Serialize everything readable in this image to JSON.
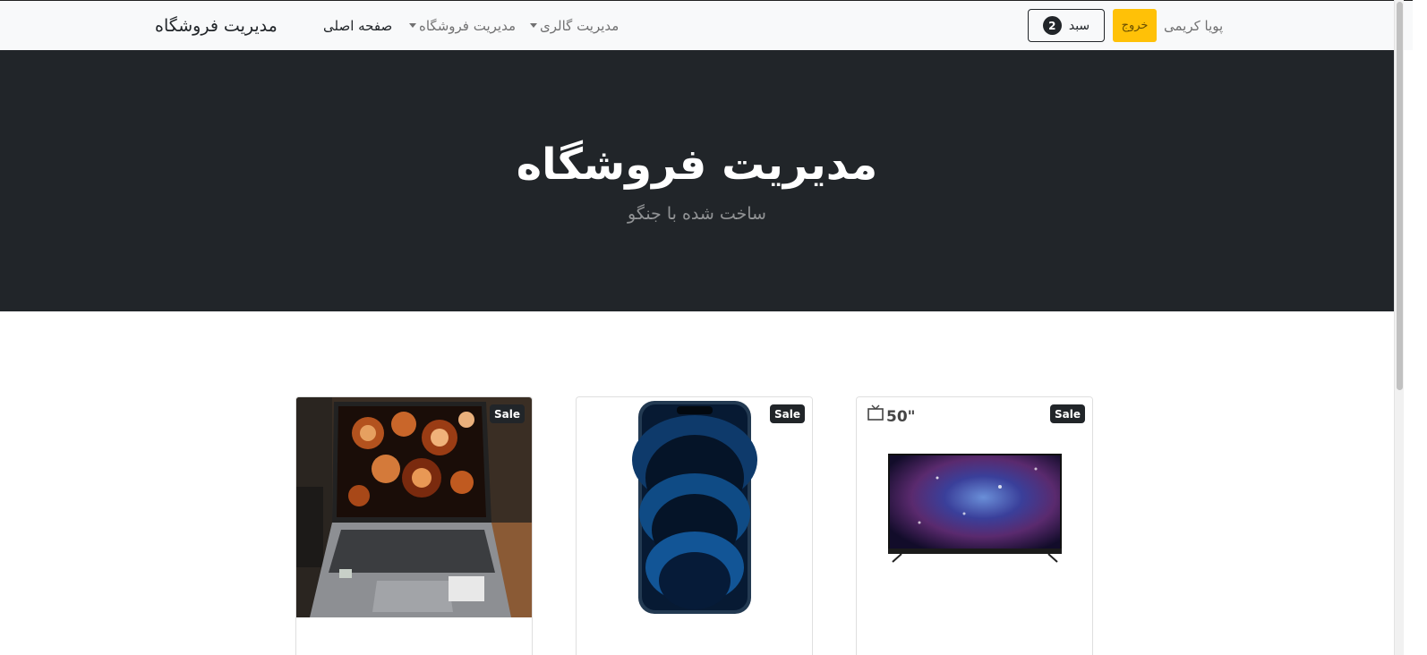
{
  "navbar": {
    "brand": "مدیریت فروشگاه",
    "links": [
      {
        "label": "صفحه اصلی",
        "active": true
      },
      {
        "label": "مدیریت فروشگاه",
        "dropdown": true
      },
      {
        "label": "مدیریت گالری",
        "dropdown": true
      }
    ],
    "cart": {
      "label": "سبد",
      "count": "2"
    },
    "logout_label": "خروج",
    "user_name": "پویا کریمی"
  },
  "hero": {
    "title": "مدیریت فروشگاه",
    "subtitle": "ساخت شده با جنگو"
  },
  "products": [
    {
      "badge": "Sale",
      "title": "",
      "image": "laptop-photo"
    },
    {
      "badge": "Sale",
      "title": "",
      "image": "smartphone-photo"
    },
    {
      "badge": "Sale",
      "title": "",
      "image": "television-photo",
      "image_overlay_text": "50\""
    }
  ],
  "colors": {
    "navbar_bg": "#f8f9fa",
    "hero_bg": "#212529",
    "logout_bg": "#ffc107",
    "badge_bg": "#212529",
    "link_blue": "#0d6efd"
  }
}
